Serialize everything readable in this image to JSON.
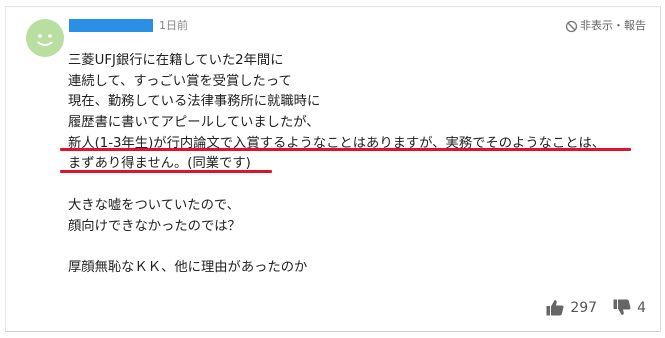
{
  "comment": {
    "username": "• • • • • •",
    "timestamp": "1日前",
    "report_label": "非表示・報告",
    "lines": [
      "三菱UFJ銀行に在籍していた2年間に",
      "連続して、すっごい賞を受賞したって",
      "現在、勤務している法律事務所に就職時に",
      "履歴書に書いてアピールしていましたが、",
      "新人(1-3年生)が行内論文で入賞するようなことはありますが、実務でそのようなことは、",
      "まずあり得ません。(同業です)",
      "",
      "大きな嘘をついていたので、",
      "顔向けできなかったのでは？",
      "",
      "厚顔無恥なＫＫ、他に理由があったのか"
    ],
    "likes": "297",
    "dislikes": "4"
  },
  "colors": {
    "username_bar": "#2b8fe6",
    "avatar": "#b8dea0",
    "red_underline": "#e4112a"
  },
  "icons": {
    "avatar": "smiley-face-icon",
    "report": "prohibited-icon",
    "like": "thumbs-up-icon",
    "dislike": "thumbs-down-icon"
  }
}
